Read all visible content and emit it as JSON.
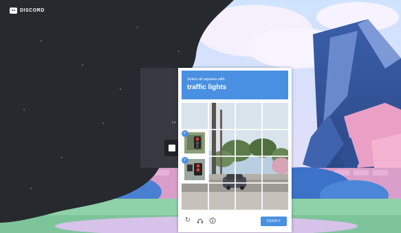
{
  "brand": {
    "name": "DISCORD"
  },
  "login": {
    "snippet": "Lo"
  },
  "captcha": {
    "instruction": "Select all squares with",
    "keyword": "traffic lights",
    "grid": {
      "rows": 4,
      "cols": 4,
      "selected": [
        [
          1,
          0
        ],
        [
          2,
          0
        ]
      ]
    },
    "footer": {
      "refresh_icon": "refresh-icon",
      "audio_icon": "headphones-icon",
      "info_icon": "info-icon",
      "verify_label": "VERIFY"
    },
    "colors": {
      "accent": "#4a90e2"
    }
  },
  "colors": {
    "dark": "#23272a",
    "card": "#36393f"
  }
}
